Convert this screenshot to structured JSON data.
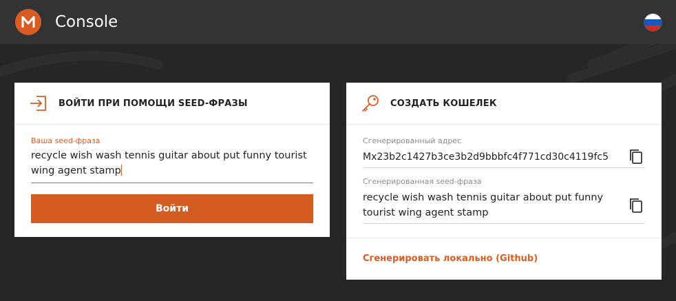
{
  "header": {
    "logo_letter": "M",
    "title": "Console",
    "language_flag": "russia-flag-icon"
  },
  "login_card": {
    "title": "ВОЙТИ ПРИ ПОМОЩИ SEED-ФРАЗЫ",
    "icon": "login-icon",
    "seed_label": "Ваша seed-фраза",
    "seed_value": "recycle wish wash tennis guitar about put funny tourist wing agent stamp",
    "button_label": "Войти"
  },
  "create_card": {
    "title": "СОЗДАТЬ КОШЕЛЕК",
    "icon": "key-icon",
    "address_label": "Сгенерированный адрес",
    "address_value": "Mx23b2c1427b3ce3b2d9bbbfc4f771cd30c4119fc5",
    "seed_label": "Сгенерированная seed-фраза",
    "seed_value": "recycle wish wash tennis guitar about put funny tourist wing agent stamp",
    "github_link": "Сгенерировать локально (Github)"
  },
  "colors": {
    "accent": "#d95d22",
    "topbar": "#333333",
    "background": "#262626"
  }
}
